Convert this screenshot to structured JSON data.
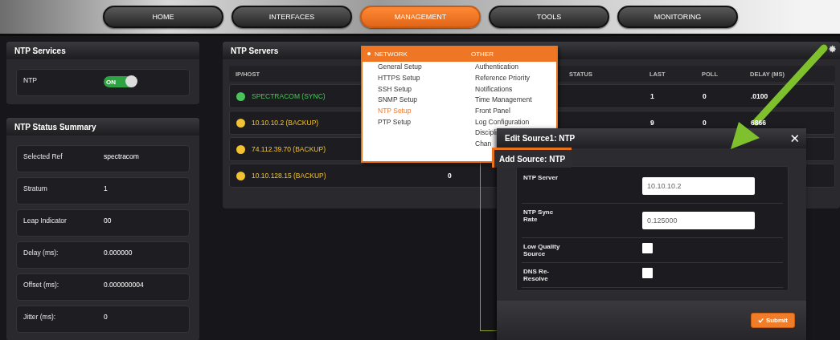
{
  "nav": [
    {
      "label": "HOME",
      "selected": false
    },
    {
      "label": "INTERFACES",
      "selected": false
    },
    {
      "label": "MANAGEMENT",
      "selected": true
    },
    {
      "label": "TOOLS",
      "selected": false
    },
    {
      "label": "MONITORING",
      "selected": false
    }
  ],
  "services": {
    "title": "NTP Services",
    "rows": [
      {
        "label": "NTP",
        "on": true,
        "toggle_text": "ON"
      }
    ]
  },
  "status_summary": {
    "title": "NTP Status Summary",
    "rows": [
      {
        "label": "Selected Ref",
        "value": "spectracom"
      },
      {
        "label": "Stratum",
        "value": "1"
      },
      {
        "label": "Leap Indicator",
        "value": "00"
      },
      {
        "label": "Delay (ms):",
        "value": "0.000000"
      },
      {
        "label": "Offset (ms):",
        "value": "0.000000004"
      },
      {
        "label": "Jitter (ms):",
        "value": "0"
      }
    ]
  },
  "servers": {
    "title": "NTP Servers",
    "headers": {
      "host": "IP/HOST",
      "status": "STATUS",
      "last": "LAST",
      "poll": "POLL",
      "delay": "DELAY (MS)"
    },
    "rows": [
      {
        "host": "SPECTRACOM (SYNC)",
        "color": "#4cc35a",
        "column_2": "",
        "last": "1",
        "poll": "0",
        "delay": ".0100"
      },
      {
        "host": "10.10.10.2 (BACKUP)",
        "color": "#f2c230",
        "column_2": "",
        "last": "9",
        "poll": "0",
        "delay": "6866"
      },
      {
        "host": "74.112.39.70 (BACKUP)",
        "color": "#f2c230",
        "column_2": "",
        "last": "",
        "poll": "",
        "delay": ""
      },
      {
        "host": "10.10.128.15 (BACKUP)",
        "color": "#f2c230",
        "column_2": "0",
        "last": "",
        "poll": "",
        "delay": ""
      }
    ]
  },
  "menu": {
    "columns": [
      {
        "heading": "NETWORK",
        "selected": true,
        "items": [
          {
            "label": "General Setup",
            "selected": false
          },
          {
            "label": "HTTPS Setup",
            "selected": false
          },
          {
            "label": "SSH Setup",
            "selected": false
          },
          {
            "label": "SNMP Setup",
            "selected": false
          },
          {
            "label": "NTP Setup",
            "selected": true
          },
          {
            "label": "PTP Setup",
            "selected": false
          }
        ]
      },
      {
        "heading": "OTHER",
        "selected": false,
        "items": [
          {
            "label": "Authentication",
            "selected": false
          },
          {
            "label": "Reference Priority",
            "selected": false
          },
          {
            "label": "Notifications",
            "selected": false
          },
          {
            "label": "Time Management",
            "selected": false
          },
          {
            "label": "Front Panel",
            "selected": false
          },
          {
            "label": "Log Configuration",
            "selected": false
          },
          {
            "label": "Discipli",
            "selected": false
          },
          {
            "label": "Chan",
            "selected": false
          }
        ]
      }
    ]
  },
  "edit_dialog": {
    "title": "Edit Source1: NTP",
    "close": "✕"
  },
  "add_dialog": {
    "title": "Add Source: NTP",
    "fields": [
      {
        "kind": "text",
        "label": "NTP Server",
        "value": "10.10.10.2"
      },
      {
        "kind": "text",
        "label": "NTP Sync Rate",
        "value": "0.125000"
      },
      {
        "kind": "checkbox",
        "label": "Low Quality Source",
        "checked": false
      },
      {
        "kind": "checkbox",
        "label": "DNS Re-Resolve",
        "checked": false
      }
    ],
    "submit": "Submit"
  }
}
